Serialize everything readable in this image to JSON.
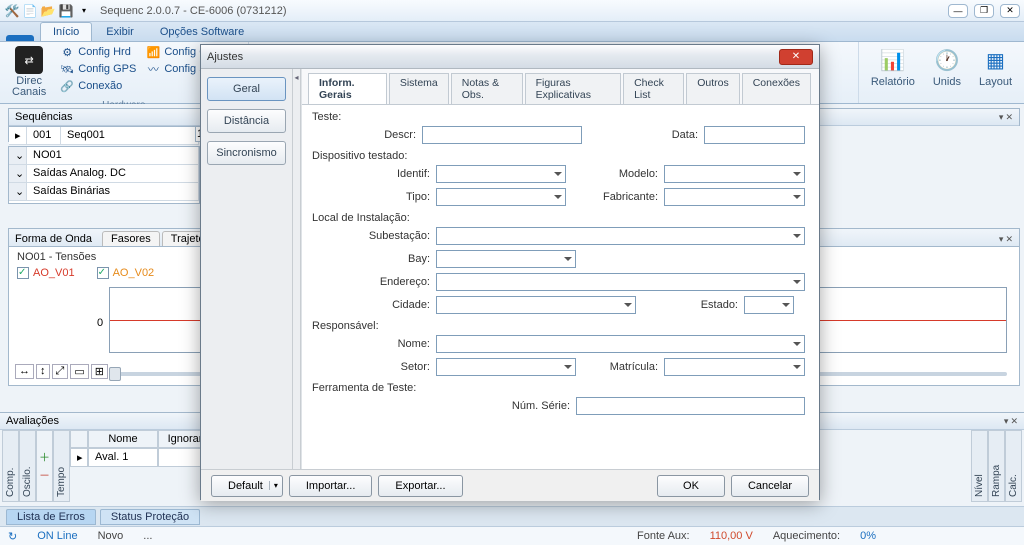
{
  "titlebar": {
    "title": "Sequenc 2.0.0.7 - CE-6006 (0731212)"
  },
  "ribbon": {
    "tabs": {
      "file": " ",
      "t0": "Início",
      "t1": "Exibir",
      "t2": "Opções Software"
    },
    "hardware": {
      "direc": "Direc\nCanais",
      "items": {
        "hrd": "Config Hrd",
        "goose": "Config GOOSE",
        "gps": "Config GPS",
        "sv": "Config SV",
        "conexao": "Conexão"
      },
      "caption": "Hardware"
    },
    "right": {
      "relatorio": "Relatório",
      "unids": "Unids",
      "layout": "Layout"
    }
  },
  "sequencias": {
    "title": "Sequências",
    "row": {
      "n": "001",
      "name": "Seq001",
      "c3": "1"
    },
    "sub": {
      "a": "NO01",
      "b": "Saídas Analog. DC",
      "c": "Saídas Binárias"
    }
  },
  "forma": {
    "title": "Forma de Onda",
    "tabs": {
      "fas": "Fasores",
      "traj": "Trajetórias"
    },
    "section": "NO01 - Tensões",
    "s1": "AO_V01",
    "s2": "AO_V02",
    "zero": "0"
  },
  "aval": {
    "title": "Avaliações",
    "cols": {
      "nome": "Nome",
      "ignorar": "Ignorar antes"
    },
    "row1": "Aval. 1",
    "side": {
      "comp": "Comp.",
      "oscilo": "Oscilo.",
      "tempo": "Tempo"
    },
    "rside": {
      "nivel": "Nível",
      "rampa": "Rampa",
      "calc": "Calc."
    }
  },
  "bottom": {
    "tab1": "Lista de Erros",
    "tab2": "Status Proteção"
  },
  "status": {
    "online": "ON Line",
    "novo": "Novo",
    "dots": "...",
    "fonte_l": "Fonte Aux:",
    "fonte_v": "110,00 V",
    "aquec_l": "Aquecimento:",
    "aquec_v": "0%"
  },
  "dialog": {
    "title": "Ajustes",
    "nav": {
      "geral": "Geral",
      "dist": "Distância",
      "sinc": "Sincronismo"
    },
    "subtabs": {
      "t0": "Inform. Gerais",
      "t1": "Sistema",
      "t2": "Notas & Obs.",
      "t3": "Figuras Explicativas",
      "t4": "Check List",
      "t5": "Outros",
      "t6": "Conexões"
    },
    "groups": {
      "teste": "Teste:",
      "disp": "Dispositivo testado:",
      "local": "Local de Instalação:",
      "resp": "Responsável:",
      "ferr": "Ferramenta de Teste:"
    },
    "labels": {
      "descr": "Descr:",
      "data": "Data:",
      "identif": "Identif:",
      "modelo": "Modelo:",
      "tipo": "Tipo:",
      "fabricante": "Fabricante:",
      "subest": "Subestação:",
      "bay": "Bay:",
      "endereco": "Endereço:",
      "cidade": "Cidade:",
      "estado": "Estado:",
      "nome": "Nome:",
      "setor": "Setor:",
      "matricula": "Matrícula:",
      "serie": "Núm. Série:"
    },
    "foot": {
      "default": "Default",
      "importar": "Importar...",
      "exportar": "Exportar...",
      "ok": "OK",
      "cancelar": "Cancelar"
    }
  }
}
